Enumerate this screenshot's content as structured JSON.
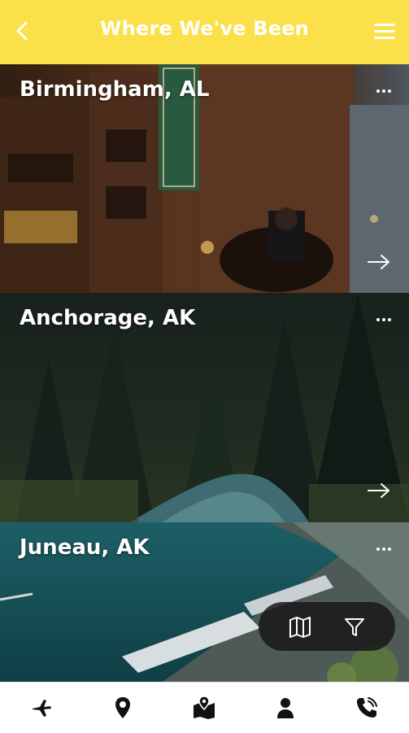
{
  "header": {
    "title": "Where We've Been",
    "back_icon": "chevron-left-icon",
    "menu_icon": "hamburger-menu-icon",
    "bg_color": "#fbe04a"
  },
  "places": [
    {
      "name": "Birmingham, AL",
      "more_icon": "more-horizontal-icon",
      "arrow_icon": "arrow-right-icon"
    },
    {
      "name": "Anchorage, AK",
      "more_icon": "more-horizontal-icon",
      "arrow_icon": "arrow-right-icon"
    },
    {
      "name": "Juneau, AK",
      "more_icon": "more-horizontal-icon"
    }
  ],
  "floating_actions": {
    "map_icon": "map-icon",
    "filter_icon": "filter-icon"
  },
  "bottom_nav": [
    {
      "icon": "airplane-icon"
    },
    {
      "icon": "map-pin-icon"
    },
    {
      "icon": "map-location-icon"
    },
    {
      "icon": "user-icon"
    },
    {
      "icon": "phone-call-icon"
    }
  ]
}
